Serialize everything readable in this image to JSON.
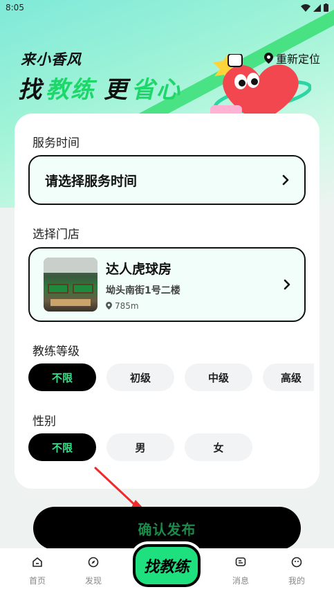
{
  "status_bar": {
    "time": "8:05"
  },
  "hero": {
    "slogan_small": "来小香风",
    "slogan_big_part1": "找",
    "slogan_big_part2": "教练",
    "slogan_big_part3": "更",
    "slogan_big_part4": "省心",
    "relocate_label": "重新定位"
  },
  "service_time": {
    "label": "服务时间",
    "placeholder": "请选择服务时间"
  },
  "store": {
    "label": "选择门店",
    "name": "达人虎球房",
    "address": "坳头南街1号二楼",
    "distance": "785m"
  },
  "coach_level": {
    "label": "教练等级",
    "options": [
      "不限",
      "初级",
      "中级",
      "高级"
    ],
    "selected": "不限"
  },
  "gender": {
    "label": "性别",
    "options": [
      "不限",
      "男",
      "女"
    ],
    "selected": "不限"
  },
  "publish_button": {
    "label": "确认发布"
  },
  "tabbar": {
    "items": [
      {
        "label": "首页",
        "icon": "home-icon"
      },
      {
        "label": "发现",
        "icon": "compass-icon"
      },
      {
        "label": "找教练",
        "icon": "find-coach-button"
      },
      {
        "label": "消息",
        "icon": "message-icon"
      },
      {
        "label": "我的",
        "icon": "profile-icon"
      }
    ]
  },
  "colors": {
    "accent_green": "#1fe07f",
    "selected_chip_text": "#36e08a",
    "card_field_bg": "#f1fef9"
  }
}
